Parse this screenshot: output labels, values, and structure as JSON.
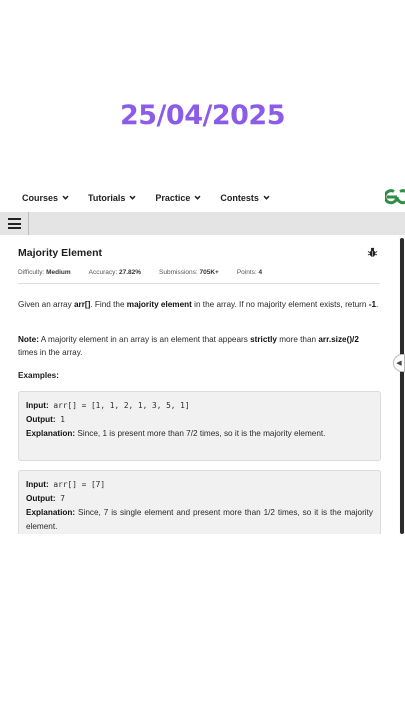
{
  "overlay": {
    "date": "25/04/2025"
  },
  "nav": {
    "items": [
      {
        "label": "Courses"
      },
      {
        "label": "Tutorials"
      },
      {
        "label": "Practice"
      },
      {
        "label": "Contests"
      }
    ],
    "logo_icon": "gfg-logo-icon",
    "brand_color": "#2f8d46"
  },
  "toolbar": {
    "menu_icon": "hamburger-icon"
  },
  "problem": {
    "title": "Majority Element",
    "report_icon": "bug-icon",
    "difficulty_label": "Difficulty:",
    "difficulty_value": "Medium",
    "accuracy_label": "Accuracy:",
    "accuracy_value": "27.82%",
    "submissions_label": "Submissions:",
    "submissions_value": "705K+",
    "points_label": "Points:",
    "points_value": "4",
    "desc1_a": "Given an array ",
    "desc1_b": "arr[]",
    "desc1_c": ". Find the ",
    "desc1_d": "majority element",
    "desc1_e": " in the array. If no majority element exists, return ",
    "desc1_f": "-1",
    "desc1_g": ".",
    "note_label": "Note:",
    "note_a": " A majority element in an array is an element that appears ",
    "note_b": "strictly",
    "note_c": " more than ",
    "note_d": "arr.size()/2",
    "note_e": " times in the array.",
    "examples_heading": "Examples:",
    "examples": [
      {
        "input_label": "Input:",
        "input_value": " arr[] = [1, 1, 2, 1, 3, 5, 1]",
        "output_label": "Output:",
        "output_value": " 1",
        "explanation_label": "Explanation:",
        "explanation_value": " Since, 1 is present more than 7/2 times, so it is the majority element."
      },
      {
        "input_label": "Input:",
        "input_value": " arr[] = [7]",
        "output_label": "Output:",
        "output_value": " 7",
        "explanation_label": "Explanation:",
        "explanation_value": " Since, 7 is single element and present more than 1/2 times, so it is the majority element."
      }
    ]
  }
}
